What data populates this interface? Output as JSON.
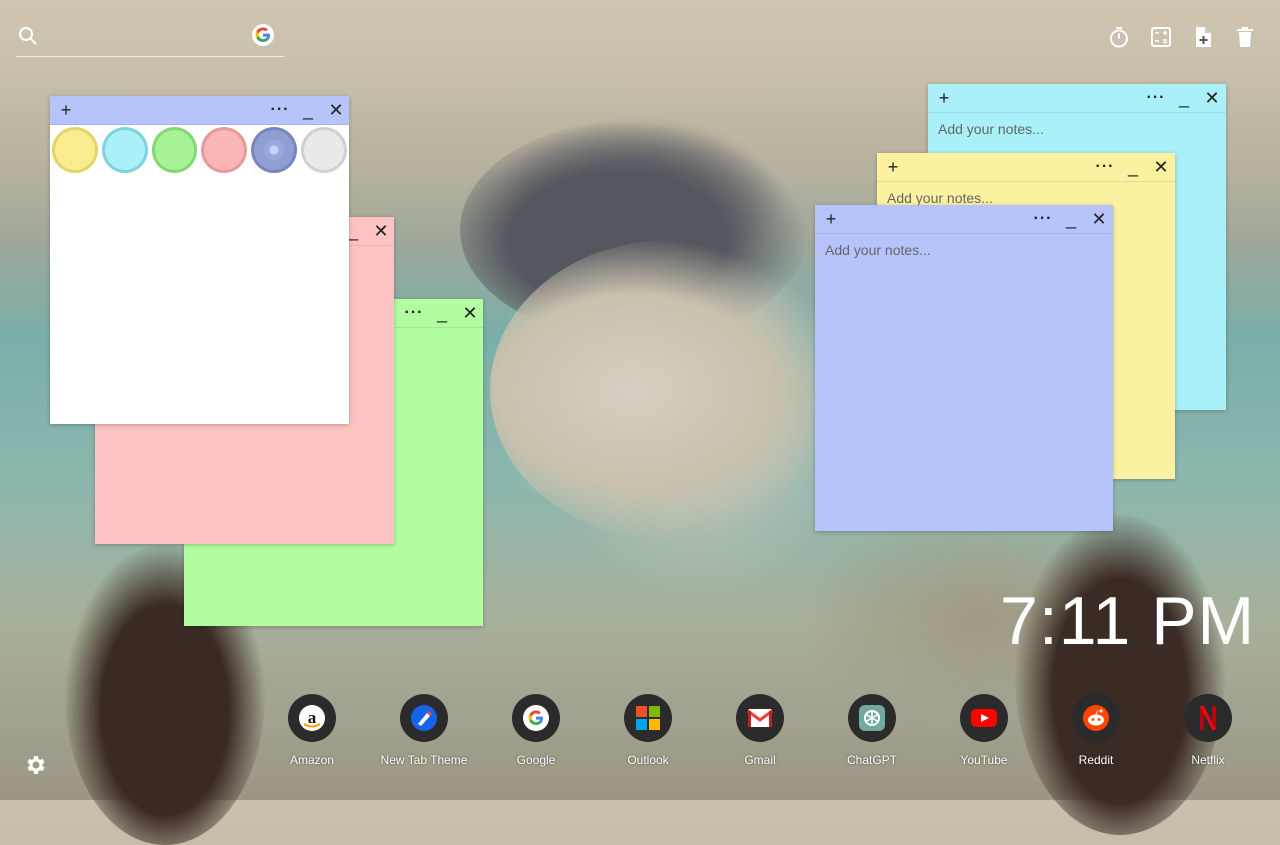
{
  "search": {
    "placeholder": "",
    "icon": "search-icon",
    "engine_icon": "google-icon"
  },
  "tools": [
    {
      "name": "timer-icon"
    },
    {
      "name": "calculator-icon"
    },
    {
      "name": "add-note-icon"
    },
    {
      "name": "trash-icon"
    }
  ],
  "notes": [
    {
      "id": "blue-note",
      "color": "#a9f0f8",
      "placeholder": "Add your notes..."
    },
    {
      "id": "yellow-note",
      "color": "#fbf1a0",
      "placeholder": "Add your notes..."
    },
    {
      "id": "lavender-note",
      "color": "#b7c4fb",
      "placeholder": "Add your notes..."
    },
    {
      "id": "pink-note",
      "color": "#fdc2c2",
      "placeholder": ""
    },
    {
      "id": "green-note",
      "color": "#b1fda0",
      "placeholder": ""
    },
    {
      "id": "white-note",
      "color": "#ffffff",
      "header_color": "#b7c4fb",
      "placeholder": ""
    }
  ],
  "note_buttons": {
    "add": "+",
    "more": "···",
    "minimize": "_",
    "close": "✕"
  },
  "color_picker": [
    "#f9ec8f",
    "#a9f0f8",
    "#a7f296",
    "#fbb7b7",
    "#8f9fd4",
    "#e9e9e9"
  ],
  "clock": {
    "time": "7:11 PM"
  },
  "shortcuts": [
    {
      "label": "Amazon",
      "icon": "amazon-icon"
    },
    {
      "label": "New Tab Theme",
      "icon": "new-tab-theme-icon"
    },
    {
      "label": "Google",
      "icon": "google-icon"
    },
    {
      "label": "Outlook",
      "icon": "outlook-icon"
    },
    {
      "label": "Gmail",
      "icon": "gmail-icon"
    },
    {
      "label": "ChatGPT",
      "icon": "chatgpt-icon"
    },
    {
      "label": "YouTube",
      "icon": "youtube-icon"
    },
    {
      "label": "Reddit",
      "icon": "reddit-icon"
    },
    {
      "label": "Netflix",
      "icon": "netflix-icon"
    }
  ],
  "settings": {
    "icon": "gear-icon"
  }
}
